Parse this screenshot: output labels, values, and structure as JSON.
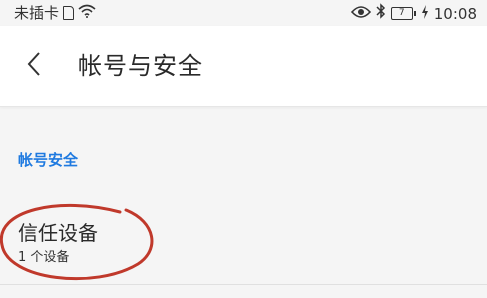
{
  "status_bar": {
    "carrier_text": "未插卡",
    "sim_label": "",
    "battery_level": "7",
    "time": "10:08",
    "icons": [
      "sim-card-icon",
      "wifi-icon",
      "eye-icon",
      "bluetooth-icon",
      "battery-icon",
      "charging-icon"
    ]
  },
  "header": {
    "title": "帐号与安全",
    "back_icon": "chevron-left-icon"
  },
  "section": {
    "title": "帐号安全"
  },
  "trusted_devices": {
    "title": "信任设备",
    "subtitle": "1 个设备"
  },
  "colors": {
    "accent": "#1f7ae0",
    "annotation": "#c0392b",
    "background": "#f5f5f5",
    "header_bg": "#ffffff"
  }
}
